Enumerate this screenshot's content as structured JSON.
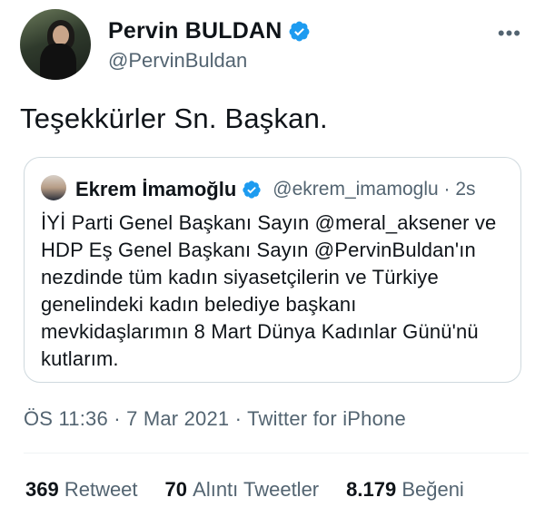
{
  "tweet": {
    "author": {
      "display_name": "Pervin BULDAN",
      "handle": "@PervinBuldan",
      "verified": true
    },
    "more_label": "•••",
    "text": "Teşekkürler Sn. Başkan.",
    "quoted": {
      "display_name": "Ekrem İmamoğlu",
      "handle_time": "@ekrem_imamoglu · 2s",
      "verified": true,
      "lines": [
        "İYİ Parti Genel Başkanı Sayın @meral_aksener ve",
        "HDP Eş Genel Başkanı Sayın @PervinBuldan'ın",
        "nezdinde tüm kadın siyasetçilerin ve Türkiye",
        "genelindeki kadın belediye başkanı",
        "mevkidaşlarımın 8 Mart Dünya Kadınlar Günü'nü",
        "kutlarım."
      ]
    },
    "timestamp": "ÖS 11:36 · 7 Mar 2021 · Twitter for iPhone",
    "stats": [
      {
        "count": "369",
        "label": "Retweet"
      },
      {
        "count": "70",
        "label": "Alıntı Tweetler"
      },
      {
        "count": "8.179",
        "label": "Beğeni"
      }
    ]
  },
  "colors": {
    "verified_blue": "#1d9bf0",
    "secondary_text": "#536471",
    "border": "#cfd9de"
  }
}
